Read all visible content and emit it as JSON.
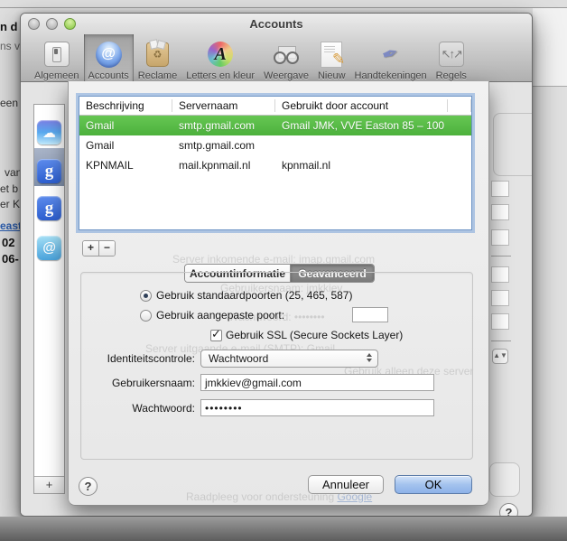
{
  "window": {
    "title": "Accounts"
  },
  "toolbar": {
    "items": [
      {
        "label": "Algemeen",
        "selected": false
      },
      {
        "label": "Accounts",
        "selected": true
      },
      {
        "label": "Reclame",
        "selected": false
      },
      {
        "label": "Letters en kleur",
        "selected": false
      },
      {
        "label": "Weergave",
        "selected": false
      },
      {
        "label": "Nieuw",
        "selected": false
      },
      {
        "label": "Handtekeningen",
        "selected": false
      },
      {
        "label": "Regels",
        "selected": false
      }
    ]
  },
  "sidebar": {
    "accounts": [
      {
        "icon": "icloud-icon",
        "glyph": "☁",
        "selected": false
      },
      {
        "icon": "google-icon",
        "glyph": "g",
        "selected": true
      },
      {
        "icon": "google-icon",
        "glyph": "g",
        "selected": false
      },
      {
        "icon": "at-icon",
        "glyph": "@",
        "selected": false
      }
    ],
    "add_button": "+"
  },
  "smtp_sheet": {
    "server_table": {
      "columns": [
        "Beschrijving",
        "Servernaam",
        "Gebruikt door account"
      ],
      "rows": [
        {
          "beschrijving": "Gmail",
          "servernaam": "smtp.gmail.com",
          "gebruikt_door": "Gmail JMK, VVE Easton 85 – 100",
          "selected": true
        },
        {
          "beschrijving": "Gmail",
          "servernaam": "smtp.gmail.com",
          "gebruikt_door": "",
          "selected": false
        },
        {
          "beschrijving": "KPNMAIL",
          "servernaam": "mail.kpnmail.nl",
          "gebruikt_door": "kpnmail.nl",
          "selected": false
        }
      ]
    },
    "add_button": "+",
    "remove_button": "−",
    "tabs": [
      {
        "label": "Accountinformatie",
        "selected": false
      },
      {
        "label": "Geavanceerd",
        "selected": true
      }
    ],
    "radio_default_ports": {
      "label": "Gebruik standaardpoorten (25, 465, 587)",
      "selected": true
    },
    "radio_custom_port": {
      "label": "Gebruik aangepaste poort:",
      "selected": false,
      "value": ""
    },
    "ssl_checkbox": {
      "label": "Gebruik SSL (Secure Sockets Layer)",
      "checked": true
    },
    "auth_popup": {
      "label": "Identiteitscontrole:",
      "value": "Wachtwoord"
    },
    "username_field": {
      "label": "Gebruikersnaam:",
      "value": "jmkkiev@gmail.com"
    },
    "password_field": {
      "label": "Wachtwoord:",
      "value": "••••••••"
    },
    "help_button": "?",
    "cancel_button": "Annuleer",
    "ok_button": "OK"
  },
  "background_pane_ghosts": {
    "lines": [
      "Server inkomende e-mail:   imap.gmail.com",
      "Gebruikersnaam:   jmkkiev",
      "Wachtwoord:   ••••••••",
      "Server uitgaande e-mail (SMTP):   Gmail",
      "Gebruik alleen deze server",
      "Raadpleeg voor ondersteuning "
    ],
    "support_link": "Google",
    "pane_help_button": "?"
  },
  "desktop_fragments": {
    "items": [
      "n d",
      "ns v",
      "een",
      "van",
      "et b",
      "er K",
      "east",
      "02",
      "06-"
    ]
  },
  "colors": {
    "selected_row_green": "#55bd47",
    "ok_button_blue": "#9ebfec",
    "focus_ring_blue": "#78a2d8",
    "link_blue": "#2a5db0",
    "sidebar_selection": "#8c9cb4"
  }
}
